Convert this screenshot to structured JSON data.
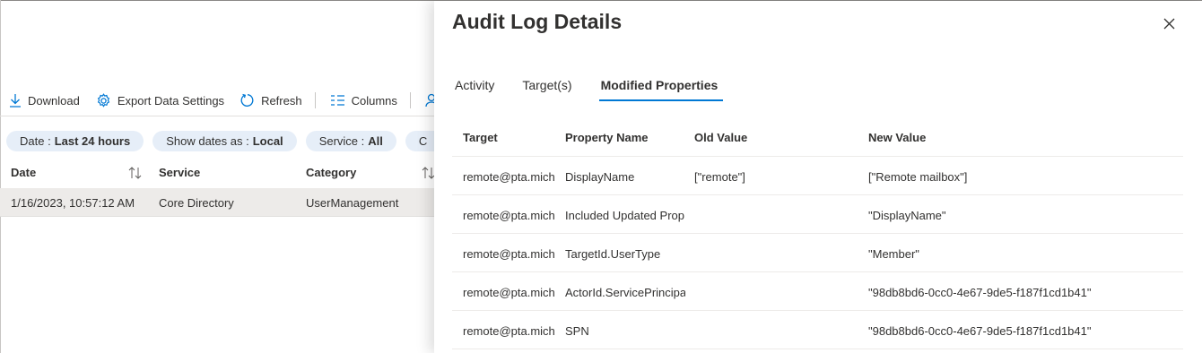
{
  "toolbar": {
    "download_label": "Download",
    "export_label": "Export Data Settings",
    "refresh_label": "Refresh",
    "columns_label": "Columns"
  },
  "filters": [
    {
      "prefix": "Date :",
      "value": "Last 24 hours"
    },
    {
      "prefix": "Show dates as :",
      "value": "Local"
    },
    {
      "prefix": "Service :",
      "value": "All"
    },
    {
      "prefix": "C",
      "value": ""
    }
  ],
  "grid": {
    "headers": {
      "date": "Date",
      "service": "Service",
      "category": "Category"
    },
    "rows": [
      {
        "date": "1/16/2023, 10:57:12 AM",
        "service": "Core Directory",
        "category": "UserManagement"
      }
    ]
  },
  "panel": {
    "title": "Audit Log Details",
    "tabs": [
      "Activity",
      "Target(s)",
      "Modified Properties"
    ],
    "active_tab": "Modified Properties",
    "table": {
      "headers": [
        "Target",
        "Property Name",
        "Old Value",
        "New Value"
      ],
      "rows": [
        {
          "target": "remote@pta.mich",
          "property": "DisplayName",
          "old": "[\"remote\"]",
          "new": "[\"Remote mailbox\"]"
        },
        {
          "target": "remote@pta.mich",
          "property": "Included Updated Prop",
          "old": "",
          "new": "\"DisplayName\""
        },
        {
          "target": "remote@pta.mich",
          "property": "TargetId.UserType",
          "old": "",
          "new": "\"Member\""
        },
        {
          "target": "remote@pta.mich",
          "property": "ActorId.ServicePrincipa",
          "old": "",
          "new": "\"98db8bd6-0cc0-4e67-9de5-f187f1cd1b41\""
        },
        {
          "target": "remote@pta.mich",
          "property": "SPN",
          "old": "",
          "new": "\"98db8bd6-0cc0-4e67-9de5-f187f1cd1b41\""
        }
      ]
    }
  },
  "colors": {
    "accent": "#0078d4",
    "pill_bg": "#e6eef8",
    "selected_row": "#edebe9"
  }
}
